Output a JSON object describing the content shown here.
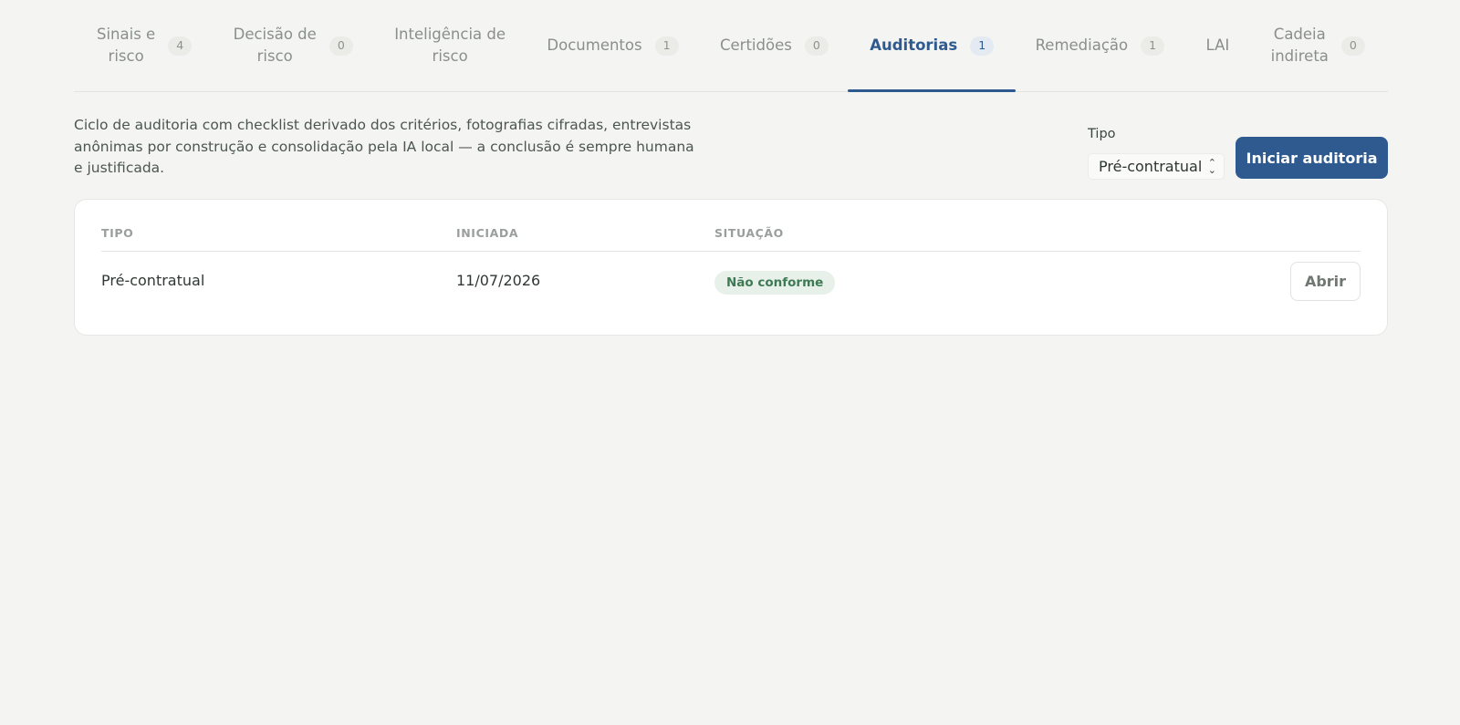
{
  "tabs": [
    {
      "label": "Sinais e\nrisco",
      "count": "4",
      "active": false
    },
    {
      "label": "Decisão de\nrisco",
      "count": "0",
      "active": false
    },
    {
      "label": "Inteligência de\nrisco",
      "count": "",
      "active": false
    },
    {
      "label": "Documentos",
      "count": "1",
      "active": false
    },
    {
      "label": "Certidões",
      "count": "0",
      "active": false
    },
    {
      "label": "Auditorias",
      "count": "1",
      "active": true
    },
    {
      "label": "Remediação",
      "count": "1",
      "active": false
    },
    {
      "label": "LAI",
      "count": "",
      "active": false
    },
    {
      "label": "Cadeia\nindireta",
      "count": "0",
      "active": false
    }
  ],
  "intro": "Ciclo de auditoria com checklist derivado dos critérios, fotografias cifradas, entrevistas anônimas por construção e consolidação pela IA local — a conclusão é sempre humana e justificada.",
  "type_filter": {
    "label": "Tipo",
    "value": "Pré-contratual"
  },
  "start_button": "Iniciar auditoria",
  "table": {
    "headers": {
      "tipo": "TIPO",
      "iniciada": "INICIADA",
      "situacao": "SITUAÇÃO"
    },
    "rows": [
      {
        "tipo": "Pré-contratual",
        "iniciada": "11/07/2026",
        "situacao": "Não conforme",
        "action": "Abrir"
      }
    ]
  },
  "colors": {
    "accent": "#2f5a8f",
    "status_bg": "#e7f1ea",
    "status_text": "#3f7a55"
  }
}
